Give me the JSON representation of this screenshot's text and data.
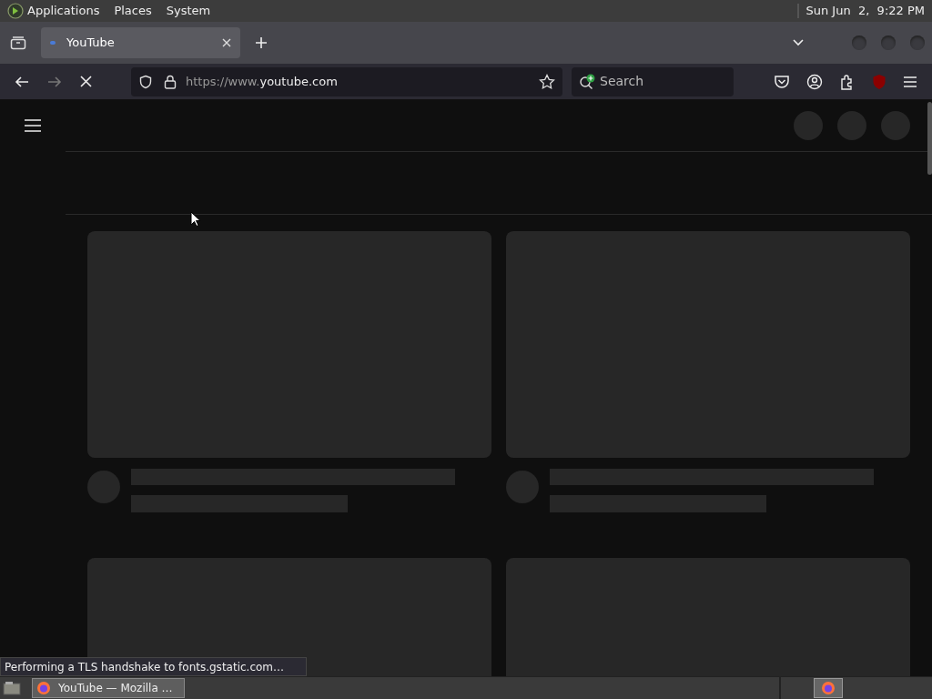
{
  "top_panel": {
    "menus": [
      "Applications",
      "Places",
      "System"
    ],
    "clock": "Sun Jun  2,  9:22 PM"
  },
  "tabs": [
    {
      "title": "YouTube",
      "selected": true
    }
  ],
  "address_bar": {
    "url_prefix": "https://www.",
    "url_domain": "youtube.com"
  },
  "search": {
    "placeholder": "Search"
  },
  "status_bar": "Performing a TLS handshake to fonts.gstatic.com…",
  "taskbar": {
    "windows": [
      {
        "title": "YouTube — Mozilla …",
        "selected": true
      }
    ]
  }
}
